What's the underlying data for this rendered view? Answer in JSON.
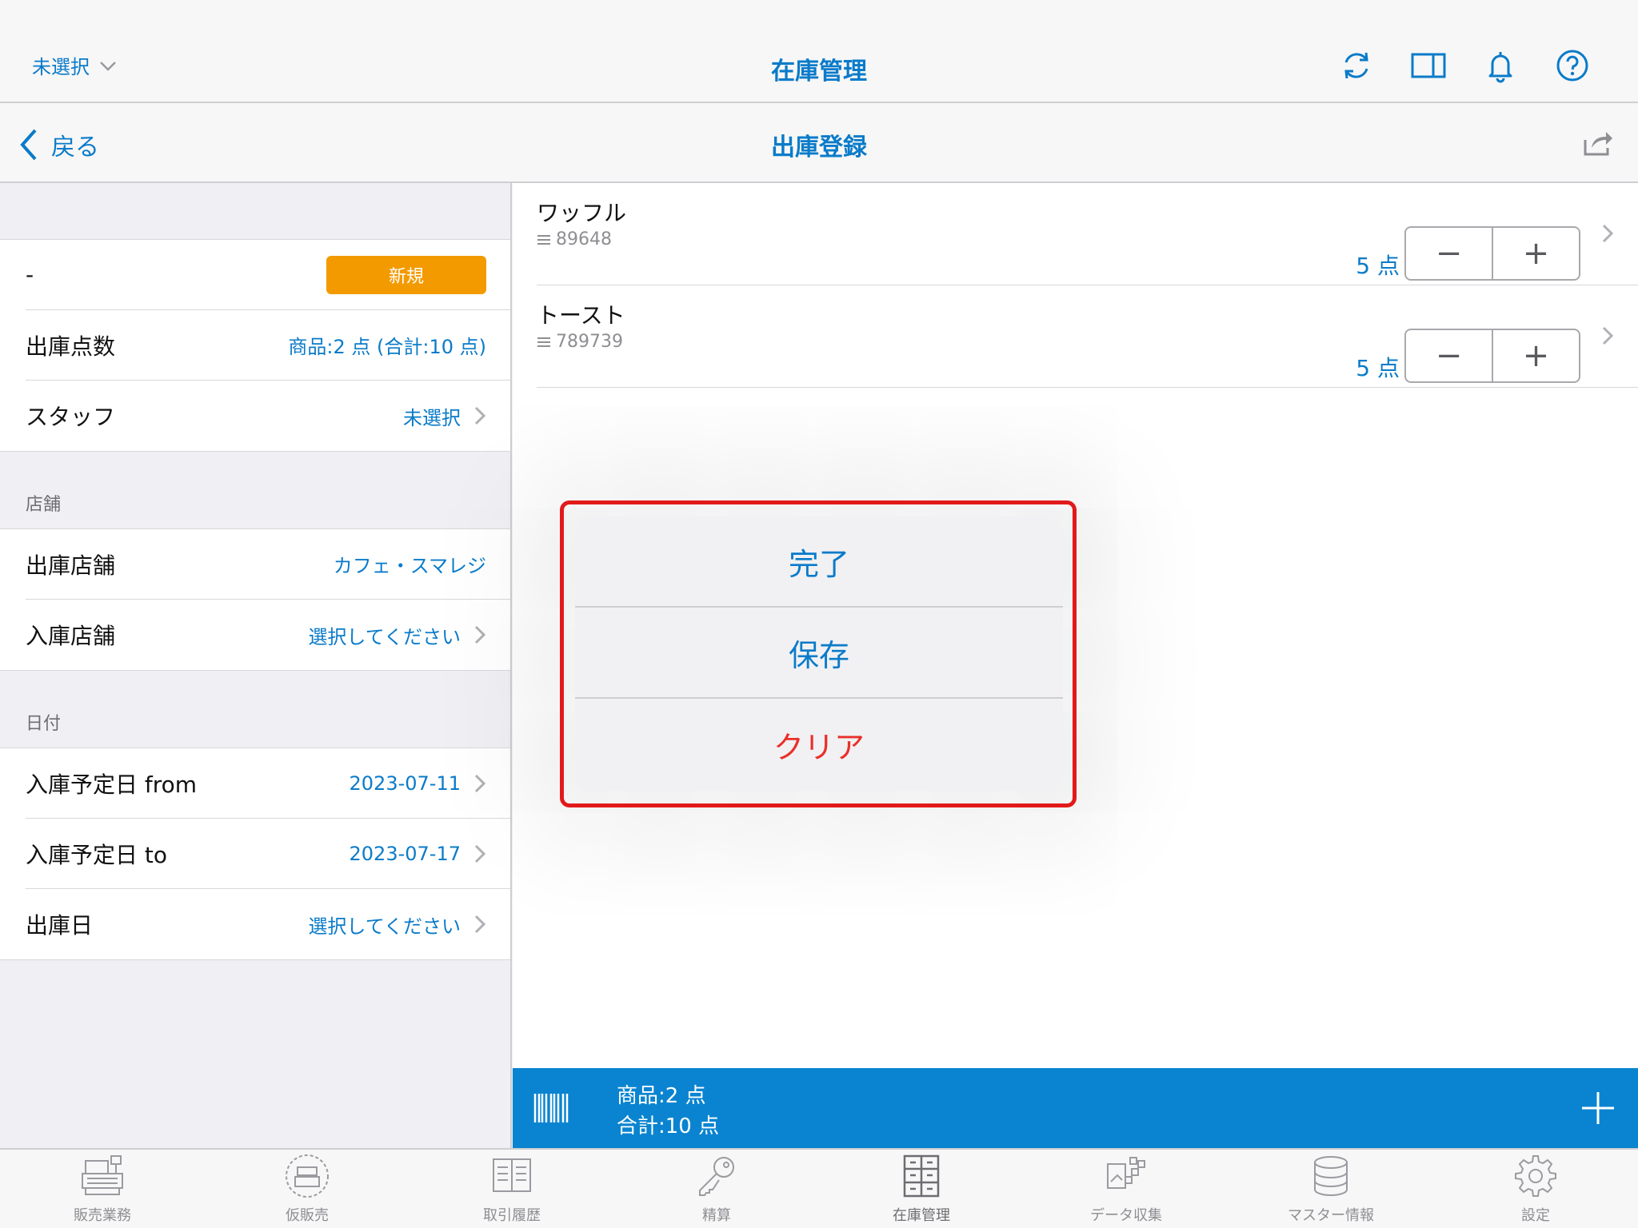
{
  "header": {
    "store_selector": "未選択",
    "title": "在庫管理",
    "icons": [
      "sync-icon",
      "split-view-icon",
      "bell-icon",
      "help-icon"
    ]
  },
  "navbar": {
    "back_label": "戻る",
    "title": "出庫登録"
  },
  "form": {
    "status_row": {
      "label": "-",
      "badge": "新規"
    },
    "count_row": {
      "label": "出庫点数",
      "value": "商品:2 点 (合計:10 点)"
    },
    "staff_row": {
      "label": "スタッフ",
      "value": "未選択"
    },
    "store_section": "店舗",
    "from_store_row": {
      "label": "出庫店舗",
      "value": "カフェ・スマレジ"
    },
    "to_store_row": {
      "label": "入庫店舗",
      "value": "選択してください"
    },
    "date_section": "日付",
    "date_from_row": {
      "label": "入庫予定日 from",
      "value": "2023-07-11"
    },
    "date_to_row": {
      "label": "入庫予定日 to",
      "value": "2023-07-17"
    },
    "ship_date_row": {
      "label": "出庫日",
      "value": "選択してください"
    }
  },
  "items": [
    {
      "name": "ワッフル",
      "code": "89648",
      "qty": "5 点",
      "minus": "−",
      "plus": "+"
    },
    {
      "name": "トースト",
      "code": "789739",
      "qty": "5 点",
      "minus": "−",
      "plus": "+"
    }
  ],
  "summary": {
    "products": "商品:2 点",
    "total": "合計:10 点"
  },
  "popover": {
    "complete": "完了",
    "save": "保存",
    "clear": "クリア"
  },
  "tabs": [
    {
      "label": "販売業務",
      "icon": "register-icon"
    },
    {
      "label": "仮販売",
      "icon": "temp-sale-icon"
    },
    {
      "label": "取引履歴",
      "icon": "history-icon"
    },
    {
      "label": "精算",
      "icon": "key-icon"
    },
    {
      "label": "在庫管理",
      "icon": "inventory-icon"
    },
    {
      "label": "データ収集",
      "icon": "data-collect-icon"
    },
    {
      "label": "マスター情報",
      "icon": "database-icon"
    },
    {
      "label": "設定",
      "icon": "gear-icon"
    }
  ],
  "colors": {
    "accent": "#0a7bc9",
    "bar": "#0a84d0",
    "badge": "#f39a00",
    "danger": "#e9302a",
    "highlight": "#e21a1a"
  }
}
